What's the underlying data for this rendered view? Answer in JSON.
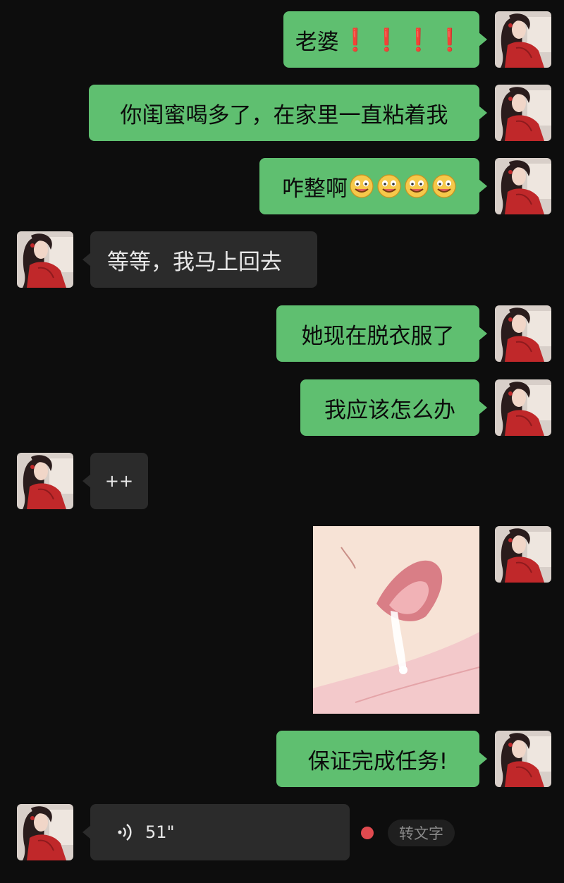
{
  "messages": [
    {
      "side": "out",
      "text": "老婆",
      "suffix": "❗❗❗❗"
    },
    {
      "side": "out",
      "text": "你闺蜜喝多了，在家里一直粘着我"
    },
    {
      "side": "out",
      "text": "咋整啊",
      "emoji": "grin-face-icon x4"
    },
    {
      "side": "in",
      "text": "等等，我马上回去"
    },
    {
      "side": "out",
      "text": "她现在脱衣服了"
    },
    {
      "side": "out",
      "text": "我应该怎么办"
    },
    {
      "side": "in",
      "text": "++"
    },
    {
      "side": "out",
      "type": "image"
    },
    {
      "side": "out",
      "text": "保证完成任务!"
    },
    {
      "side": "in",
      "type": "voice",
      "duration": "51\""
    }
  ],
  "voice": {
    "convert_label": "转文字",
    "unread_color": "#e04a4f"
  },
  "colors": {
    "background": "#0d0d0d",
    "bubble_out": "#5fbf70",
    "bubble_in": "#2b2b2b"
  }
}
